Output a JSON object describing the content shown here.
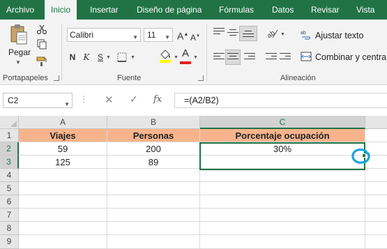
{
  "menu": {
    "tabs": [
      "Archivo",
      "Inicio",
      "Insertar",
      "Diseño de página",
      "Fórmulas",
      "Datos",
      "Revisar",
      "Vista"
    ],
    "active": "Inicio"
  },
  "ribbon": {
    "clipboard": {
      "paste_label": "Pegar",
      "group_label": "Portapapeles"
    },
    "font": {
      "name": "Calibri",
      "size": "11",
      "group_label": "Fuente",
      "bold": "N",
      "italic": "K",
      "underline": "S",
      "grow": "A",
      "shrink": "A"
    },
    "alignment": {
      "wrap_label": "Ajustar texto",
      "merge_label": "Combinar y centrar",
      "group_label": "Alineación"
    }
  },
  "formula_bar": {
    "name_box": "C2",
    "fx": "fx",
    "formula": "=(A2/B2)"
  },
  "grid": {
    "columns": [
      "A",
      "B",
      "C"
    ],
    "rows": [
      "1",
      "2",
      "3",
      "4",
      "5",
      "6",
      "7",
      "8",
      "9"
    ],
    "selected_column": "C",
    "selected_rows": [
      "2",
      "3"
    ],
    "cells": {
      "A1": "Viajes",
      "B1": "Personas",
      "C1": "Porcentaje ocupación",
      "A2": "59",
      "B2": "200",
      "C2": "30%",
      "A3": "125",
      "B3": "89",
      "C3": ""
    },
    "header_fill": "#f7b48c",
    "accent": "#217346"
  },
  "annotation": {
    "color": "#1aa3d9"
  }
}
